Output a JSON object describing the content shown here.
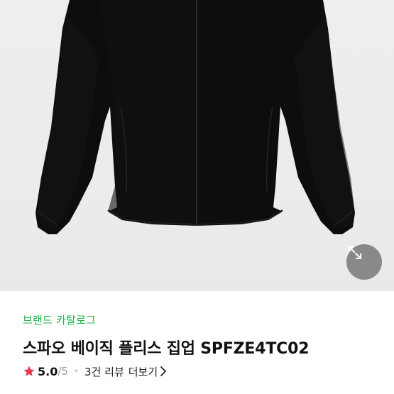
{
  "brand": {
    "label": "브랜드 카탈로그"
  },
  "product": {
    "title": "스파오 베이직 플리스 집업 SPFZE4TC02"
  },
  "rating": {
    "score": "5.0",
    "max": "/5",
    "review_count": "3건 리뷰",
    "more_label": "더보기"
  },
  "icons": {
    "zoom": "expand-arrows-icon",
    "star": "star-icon",
    "chevron": "chevron-right-icon"
  },
  "colors": {
    "brand_green": "#22b34a",
    "star_red": "#e8384f",
    "garment": "#0d0d0e",
    "zoom_bg": "#7a7a7a"
  }
}
